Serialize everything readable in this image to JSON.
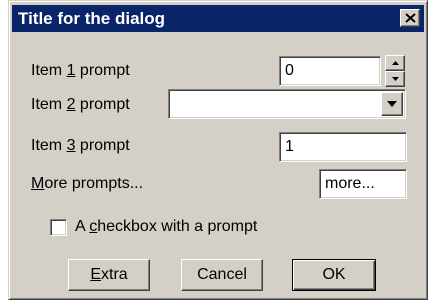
{
  "dialog": {
    "title": "Title for the dialog",
    "close_icon": "close-x-icon"
  },
  "item1": {
    "label_prefix": "Item ",
    "label_mnemonic": "1",
    "label_suffix": " prompt",
    "value": "0",
    "spinner_up_icon": "arrow-up-icon",
    "spinner_down_icon": "arrow-down-icon"
  },
  "item2": {
    "label_prefix": "Item ",
    "label_mnemonic": "2",
    "label_suffix": " prompt",
    "value": "",
    "dropdown_icon": "chevron-down-icon"
  },
  "item3": {
    "label_prefix": "Item ",
    "label_mnemonic": "3",
    "label_suffix": " prompt",
    "value": "1"
  },
  "more": {
    "label_mnemonic": "M",
    "label_rest": "ore prompts...",
    "field_value": "more..."
  },
  "checkbox": {
    "label_prefix": "A ",
    "label_mnemonic": "c",
    "label_suffix": "heckbox with a prompt",
    "checked": false
  },
  "buttons": {
    "extra_mnemonic": "E",
    "extra_rest": "xtra",
    "cancel": "Cancel",
    "ok": "OK"
  }
}
